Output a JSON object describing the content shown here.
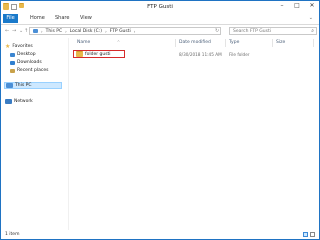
{
  "window": {
    "title": "FTP Gusti"
  },
  "ribbon": {
    "tabs": [
      "File",
      "Home",
      "Share",
      "View"
    ]
  },
  "address": {
    "segments": [
      "This PC",
      "Local Disk (C:)",
      "FTP Gusti"
    ],
    "search_placeholder": "Search FTP Gusti"
  },
  "nav": {
    "favorites": "Favorites",
    "desktop": "Desktop",
    "downloads": "Downloads",
    "recent": "Recent places",
    "thispc": "This PC",
    "network": "Network"
  },
  "columns": {
    "name": "Name",
    "date": "Date modified",
    "type": "Type",
    "size": "Size"
  },
  "files": [
    {
      "name": "folder gusti",
      "date": "8/30/2018 11:45 AM",
      "type": "File folder",
      "size": ""
    }
  ],
  "status": {
    "count": "1 item"
  },
  "colors": {
    "accent": "#1979ca",
    "highlight": "#d62b2b",
    "folder": "#e8b84b"
  }
}
